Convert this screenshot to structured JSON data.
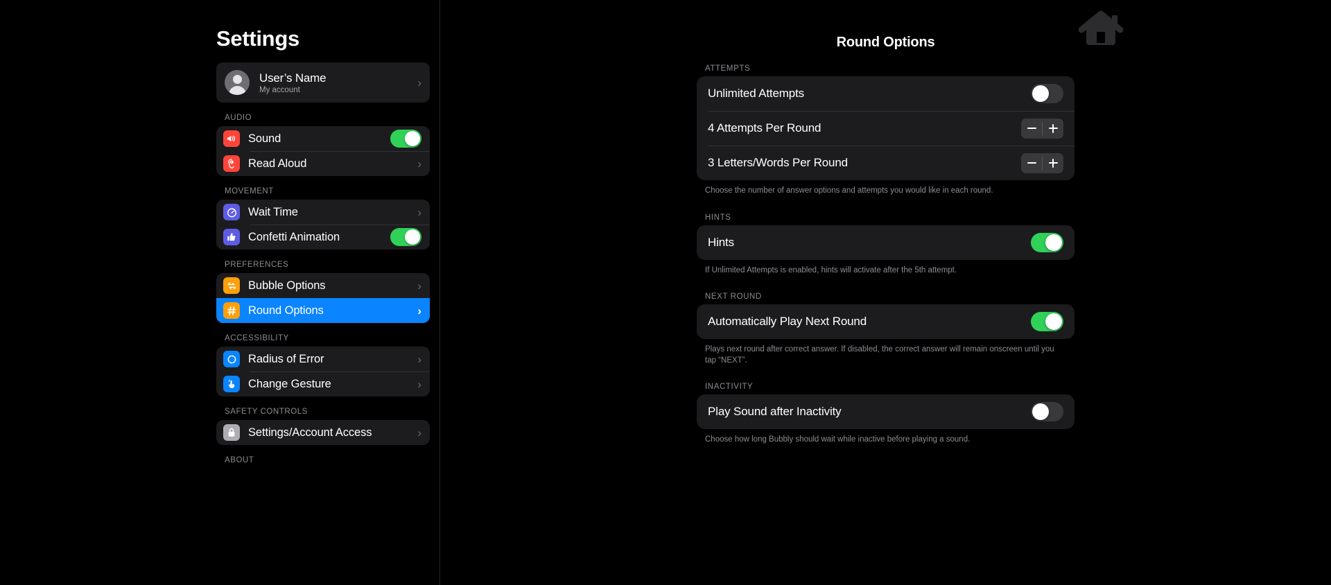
{
  "sidebar": {
    "title": "Settings",
    "account": {
      "name": "User’s Name",
      "subtitle": "My account",
      "avatar_icon": "person-avatar-icon",
      "chevron": "›"
    },
    "groups": [
      {
        "header": "AUDIO",
        "items": [
          {
            "label": "Sound",
            "icon": "speaker-wave-icon",
            "icon_color": "#ff453a",
            "accessory": "toggle",
            "toggle_on": true
          },
          {
            "label": "Read Aloud",
            "icon": "ear-listen-icon",
            "icon_color": "#ff453a",
            "accessory": "chevron",
            "toggle_on": false
          }
        ]
      },
      {
        "header": "MOVEMENT",
        "items": [
          {
            "label": "Wait Time",
            "icon": "stopwatch-timer-icon",
            "icon_color": "#5e5ce6",
            "accessory": "chevron",
            "toggle_on": false
          },
          {
            "label": "Confetti Animation",
            "icon": "thumbs-up-icon",
            "icon_color": "#5e5ce6",
            "accessory": "toggle",
            "toggle_on": true
          }
        ]
      },
      {
        "header": "PREFERENCES",
        "items": [
          {
            "label": "Bubble Options",
            "icon": "repeat-arrows-icon",
            "icon_color": "#ff9f0a",
            "accessory": "chevron",
            "toggle_on": false,
            "selected": false
          },
          {
            "label": "Round Options",
            "icon": "hashtag-icon",
            "icon_color": "#ff9f0a",
            "accessory": "chevron",
            "toggle_on": false,
            "selected": true
          }
        ]
      },
      {
        "header": "ACCESSIBILITY",
        "items": [
          {
            "label": "Radius of Error",
            "icon": "dashed-circle-icon",
            "icon_color": "#0a84ff",
            "accessory": "chevron",
            "toggle_on": false
          },
          {
            "label": "Change Gesture",
            "icon": "hand-tap-icon",
            "icon_color": "#0a84ff",
            "accessory": "chevron",
            "toggle_on": false
          }
        ]
      },
      {
        "header": "SAFETY CONTROLS",
        "items": [
          {
            "label": "Settings/Account Access",
            "icon": "lock-icon",
            "icon_color": "#aeaeb2",
            "accessory": "chevron",
            "toggle_on": false
          }
        ]
      },
      {
        "header": "ABOUT",
        "items": []
      }
    ],
    "selected_accent": "#0a84ff"
  },
  "main": {
    "title": "Round Options",
    "home_icon": "home-house-icon",
    "sections": [
      {
        "header": "ATTEMPTS",
        "rows": [
          {
            "label": "Unlimited Attempts",
            "control": "toggle",
            "on": false
          },
          {
            "label": "4 Attempts Per Round",
            "control": "stepper",
            "minus": "−",
            "plus": "+"
          },
          {
            "label": "3 Letters/Words Per Round",
            "control": "stepper",
            "minus": "−",
            "plus": "+"
          }
        ],
        "footer": "Choose the number of answer options and attempts you would like in each round."
      },
      {
        "header": "HINTS",
        "rows": [
          {
            "label": "Hints",
            "control": "toggle",
            "on": true
          }
        ],
        "footer": "If Unlimited Attempts is enabled, hints will activate after the 5th attempt."
      },
      {
        "header": "NEXT ROUND",
        "rows": [
          {
            "label": "Automatically Play Next Round",
            "control": "toggle",
            "on": true
          }
        ],
        "footer": "Plays next round after correct answer. If disabled, the correct answer will remain onscreen until you tap “NEXT”."
      },
      {
        "header": "INACTIVITY",
        "rows": [
          {
            "label": "Play Sound after Inactivity",
            "control": "toggle",
            "on": false
          }
        ],
        "footer": "Choose how long Bubbly should wait while inactive before playing a sound."
      }
    ],
    "toggle_on_color": "#30d158",
    "toggle_off_color": "#39393c"
  }
}
